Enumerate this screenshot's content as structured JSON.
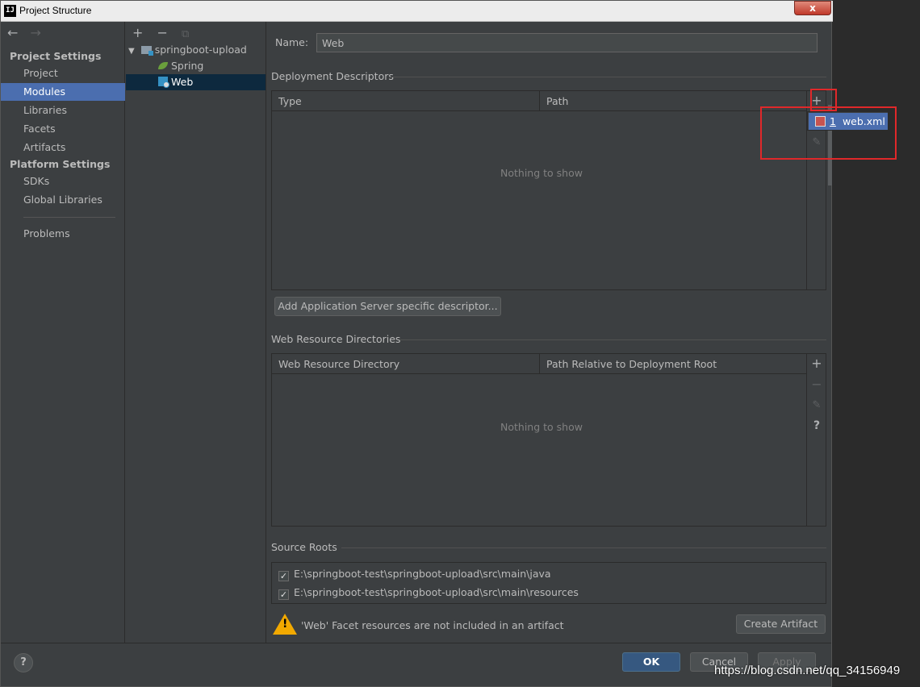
{
  "window": {
    "title": "Project Structure",
    "close_label": "x"
  },
  "nav": {
    "back": "←",
    "forward": "→"
  },
  "sidebar": {
    "project_settings_title": "Project Settings",
    "project_items": [
      {
        "label": "Project",
        "selected": false
      },
      {
        "label": "Modules",
        "selected": true
      },
      {
        "label": "Libraries",
        "selected": false
      },
      {
        "label": "Facets",
        "selected": false
      },
      {
        "label": "Artifacts",
        "selected": false
      }
    ],
    "platform_settings_title": "Platform Settings",
    "platform_items": [
      {
        "label": "SDKs"
      },
      {
        "label": "Global Libraries"
      }
    ],
    "problems_label": "Problems"
  },
  "tree": {
    "toolbar": {
      "add": "+",
      "remove": "−",
      "copy": "⧉"
    },
    "root": "springboot-upload",
    "children": [
      {
        "label": "Spring",
        "icon": "spring-icon"
      },
      {
        "label": "Web",
        "icon": "web-facet-icon",
        "selected": true
      }
    ]
  },
  "main": {
    "name_label": "Name:",
    "name_value": "Web",
    "deployment_descriptors": {
      "title": "Deployment Descriptors",
      "columns": [
        "Type",
        "Path"
      ],
      "empty_text": "Nothing to show",
      "add_server_button": "Add Application Server specific descriptor..."
    },
    "web_resources": {
      "title": "Web Resource Directories",
      "columns": [
        "Web Resource Directory",
        "Path Relative to Deployment Root"
      ],
      "empty_text": "Nothing to show"
    },
    "source_roots": {
      "title": "Source Roots",
      "items": [
        {
          "path": "E:\\springboot-test\\springboot-upload\\src\\main\\java",
          "checked": true
        },
        {
          "path": "E:\\springboot-test\\springboot-upload\\src\\main\\resources",
          "checked": true
        }
      ]
    },
    "warning": {
      "text": "'Web' Facet resources are not included in an artifact",
      "button": "Create Artifact"
    }
  },
  "popup": {
    "item_number": "1",
    "item_label": "web.xml"
  },
  "footer": {
    "help": "?",
    "ok": "OK",
    "cancel": "Cancel",
    "apply": "Apply"
  },
  "watermark": "https://blog.csdn.net/qq_34156949",
  "colors": {
    "background": "#3c3f41",
    "selection": "#4b6eaf",
    "tree_selection": "#0d293e",
    "highlight_box": "#e0282a",
    "default_button": "#365880"
  }
}
